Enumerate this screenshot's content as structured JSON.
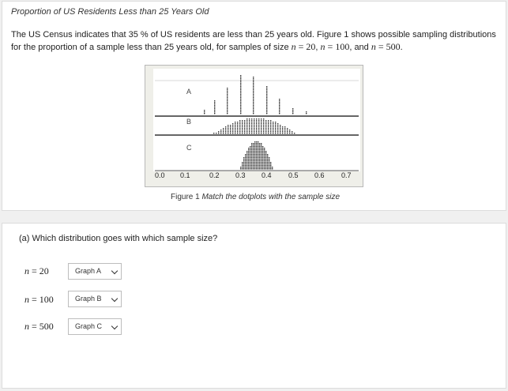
{
  "question": {
    "title": "Proportion of US Residents Less than 25 Years Old",
    "text_part1": "The US Census indicates that 35 % of US residents are less than 25 years old. Figure 1 shows possible sampling distributions for the proportion of a sample less than 25 years old, for samples of size ",
    "n_sym": "n",
    "eq": " = ",
    "n1": "20",
    "n2": "100",
    "n3": "500",
    "sep1": ", ",
    "sep2": ", and ",
    "end": "."
  },
  "figure": {
    "caption_label": "Figure 1 ",
    "caption_text": "Match the dotplots with the sample size",
    "graph_labels": [
      "A",
      "B",
      "C"
    ],
    "x_ticks": [
      "0.0",
      "0.1",
      "0.2",
      "0.3",
      "0.4",
      "0.5",
      "0.6",
      "0.7"
    ]
  },
  "part_a": {
    "question": "(a) Which distribution goes with which sample size?",
    "rows": [
      {
        "label_n": "n",
        "label_eq": " = ",
        "label_val": "20",
        "selected": "Graph A"
      },
      {
        "label_n": "n",
        "label_eq": " = ",
        "label_val": "100",
        "selected": "Graph B"
      },
      {
        "label_n": "n",
        "label_eq": " = ",
        "label_val": "500",
        "selected": "Graph C"
      }
    ]
  }
}
